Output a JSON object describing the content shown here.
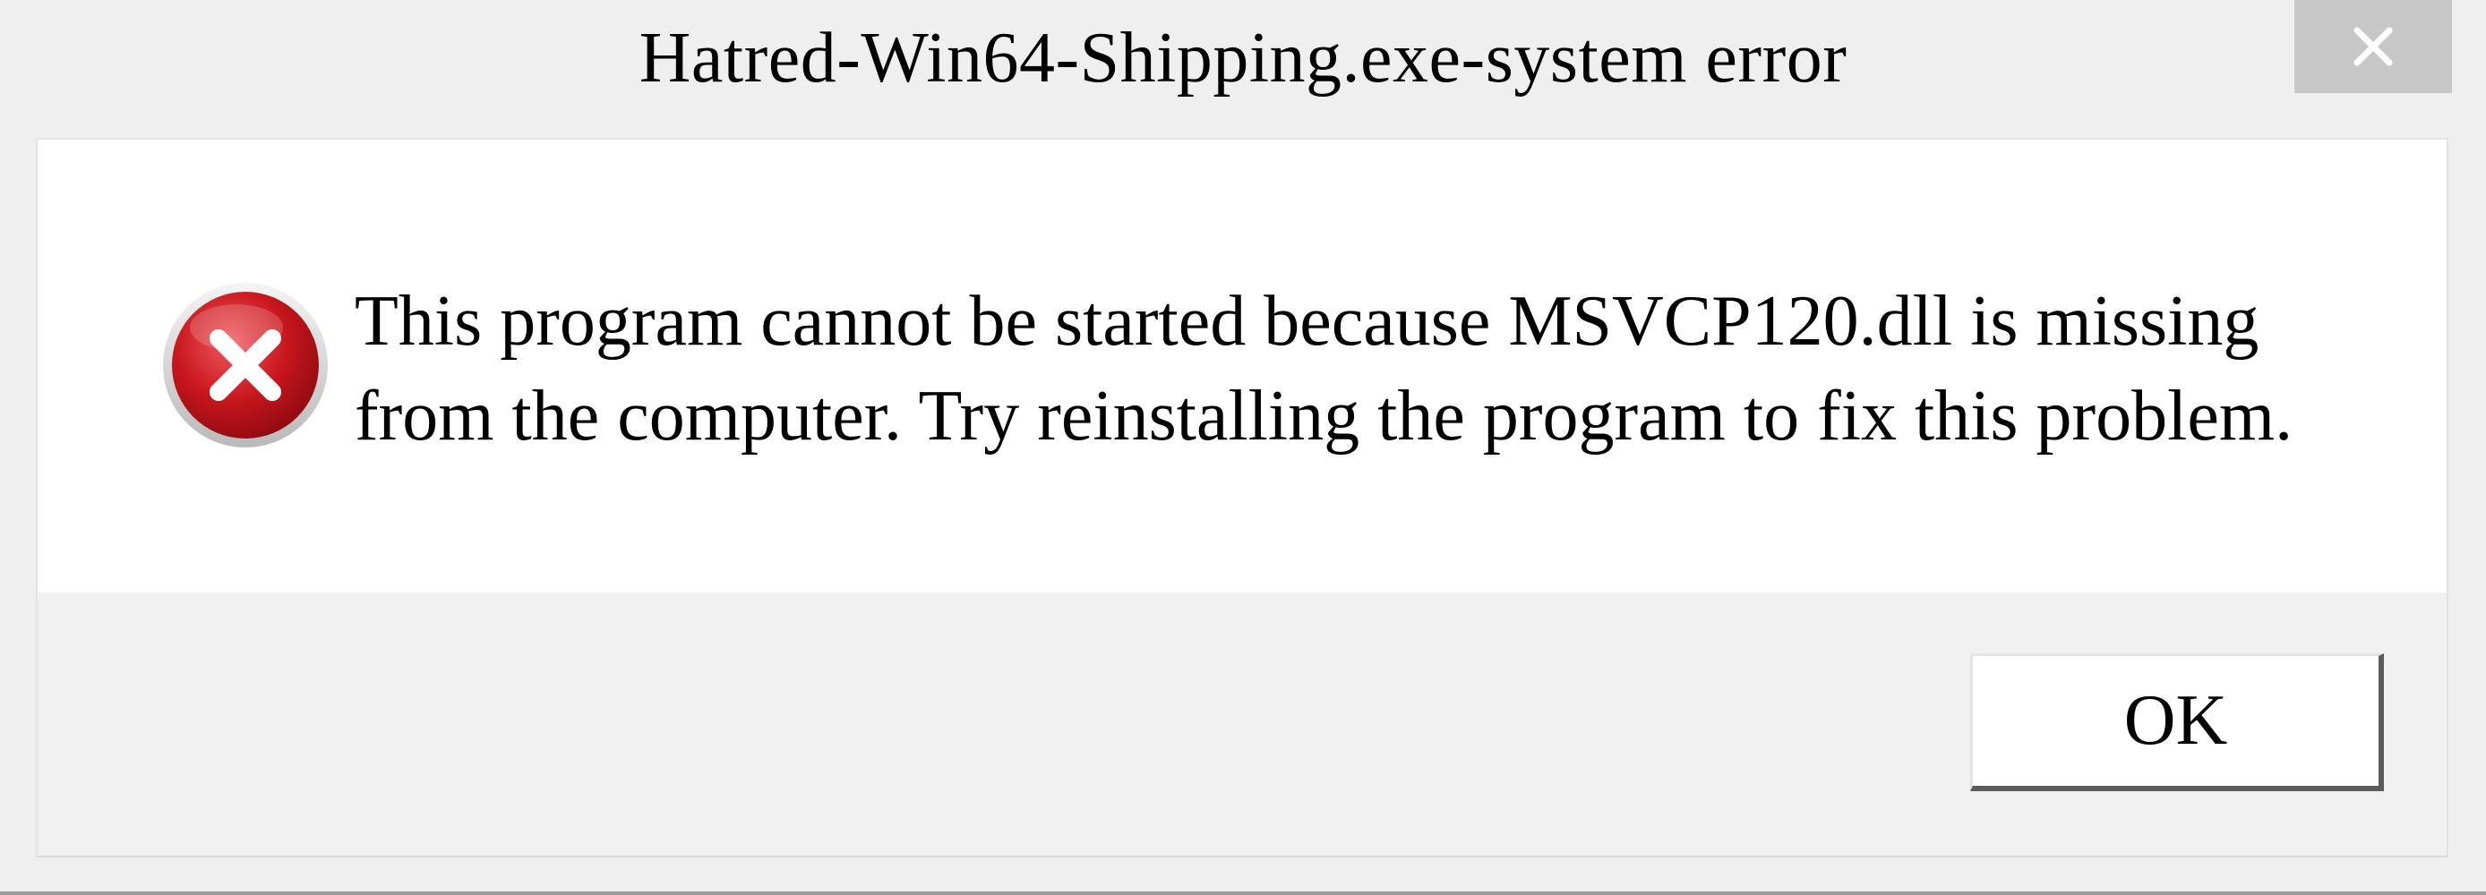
{
  "window": {
    "title": "Hatred-Win64-Shipping.exe-system error",
    "close_icon": "close-icon"
  },
  "content": {
    "icon": "error-icon",
    "message": "This program cannot be started because MSVCP120.dll is missing\nfrom the computer. Try reinstalling the program to fix this problem."
  },
  "footer": {
    "ok_label": "OK"
  },
  "colors": {
    "error_red": "#c8161d",
    "close_button_bg": "#c7c7c7",
    "content_bg": "#ffffff",
    "footer_bg": "#f0f0f0"
  }
}
